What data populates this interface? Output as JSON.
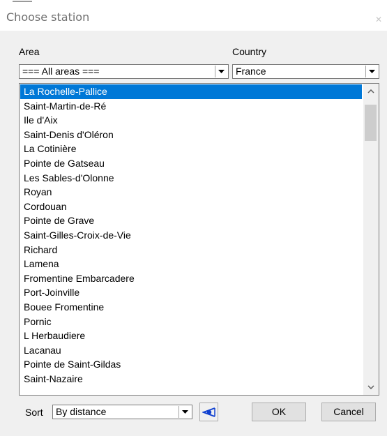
{
  "window": {
    "title": "Choose station",
    "close_icon": "close-icon"
  },
  "area": {
    "label": "Area",
    "value": "=== All areas ==="
  },
  "country": {
    "label": "Country",
    "value": "France"
  },
  "stations": {
    "selected_index": 0,
    "items": [
      "La Rochelle-Pallice",
      "Saint-Martin-de-Ré",
      "Ile d'Aix",
      "Saint-Denis d'Oléron",
      "La Cotinière",
      "Pointe de Gatseau",
      "Les Sables-d'Olonne",
      "Royan",
      "Cordouan",
      "Pointe de Grave",
      "Saint-Gilles-Croix-de-Vie",
      "Richard",
      "Lamena",
      "Fromentine Embarcadere",
      "Port-Joinville",
      "Bouee Fromentine",
      "Pornic",
      "L Herbaudiere",
      "Lacanau",
      "Pointe de Saint-Gildas",
      "Saint-Nazaire"
    ]
  },
  "sort": {
    "label": "Sort",
    "value": "By distance"
  },
  "buttons": {
    "ok": "OK",
    "cancel": "Cancel",
    "locate_icon": "eye-locate-icon"
  },
  "colors": {
    "selection": "#0078d7",
    "locate_icon": "#1040d0"
  }
}
